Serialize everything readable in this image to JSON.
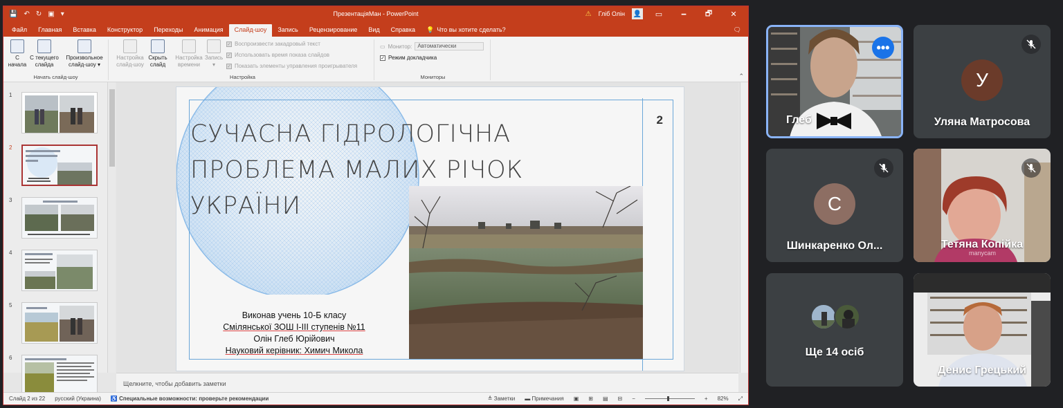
{
  "window": {
    "document_title": "ПрезентаціяМан - PowerPoint",
    "user_name": "Гліб Олін",
    "warning_icon": "warning-icon",
    "minimize": "🗕",
    "restore": "🗗",
    "close": "✕"
  },
  "qat": {
    "save": "💾",
    "undo": "↶",
    "redo": "↻",
    "present": "▣",
    "more": "▾"
  },
  "ribbon_tabs": [
    "Файл",
    "Главная",
    "Вставка",
    "Конструктор",
    "Переходы",
    "Анимация",
    "Слайд-шоу",
    "Запись",
    "Рецензирование",
    "Вид",
    "Справка"
  ],
  "active_tab": "Слайд-шоу",
  "tell_me": "Что вы хотите сделать?",
  "ribbon": {
    "start_group": {
      "label": "Начать слайд-шоу",
      "from_beginning": "С\nначала",
      "from_current": "С текущего\nслайда",
      "custom": "Произвольное\nслайд-шоу ▾"
    },
    "setup_group": {
      "label": "Настройка",
      "setup": "Настройка\nслайд-шоу",
      "hide": "Скрыть\nслайд",
      "rehearse": "Настройка\nвремени",
      "record": "Запись\n▾",
      "play_narrations": "Воспроизвести закадровый текст",
      "use_timings": "Использовать время показа слайдов",
      "show_controls": "Показать элементы управления проигрывателя"
    },
    "monitors_group": {
      "label": "Мониторы",
      "monitor_label": "Монитор:",
      "monitor_value": "Автоматически",
      "presenter_view": "Режим докладчика"
    }
  },
  "thumbnails": [
    {
      "num": "1"
    },
    {
      "num": "2"
    },
    {
      "num": "3"
    },
    {
      "num": "4"
    },
    {
      "num": "5"
    },
    {
      "num": "6"
    }
  ],
  "selected_slide": "2",
  "slide": {
    "number": "2",
    "title_lines": [
      "СУЧАСНА ГІДРОЛОГІЧНА",
      "ПРОБЛЕМА МАЛИХ РІЧОК",
      "УКРАЇНИ"
    ],
    "author_lines": [
      "Виконав учень 10-Б класу",
      "Смілянської ЗОШ І-ІІІ ступенів №11",
      "Олін Глеб Юрійович",
      "Науковий керівник: Химич Микола"
    ]
  },
  "notes_placeholder": "Щелкните, чтобы добавить заметки",
  "status": {
    "slide_count": "Слайд 2 из 22",
    "language": "русский (Украина)",
    "accessibility": "Специальные возможности: проверьте рекомендации",
    "notes": "Заметки",
    "comments": "Примечания",
    "zoom": "82%"
  },
  "participants": [
    {
      "name": "Глеб",
      "type": "video",
      "active": true
    },
    {
      "name": "Уляна Матросова",
      "initial": "У",
      "color": "#6b3b2a",
      "muted": true
    },
    {
      "name": "Шинкаренко Ол...",
      "initial": "С",
      "color": "#8d6e63",
      "muted": true
    },
    {
      "name": "Тетяна Копійка",
      "type": "video",
      "muted": true,
      "watermark": "manycam"
    },
    {
      "name": "Ще 14 осіб",
      "type": "more"
    },
    {
      "name": "Денис Грецький",
      "type": "video"
    }
  ]
}
